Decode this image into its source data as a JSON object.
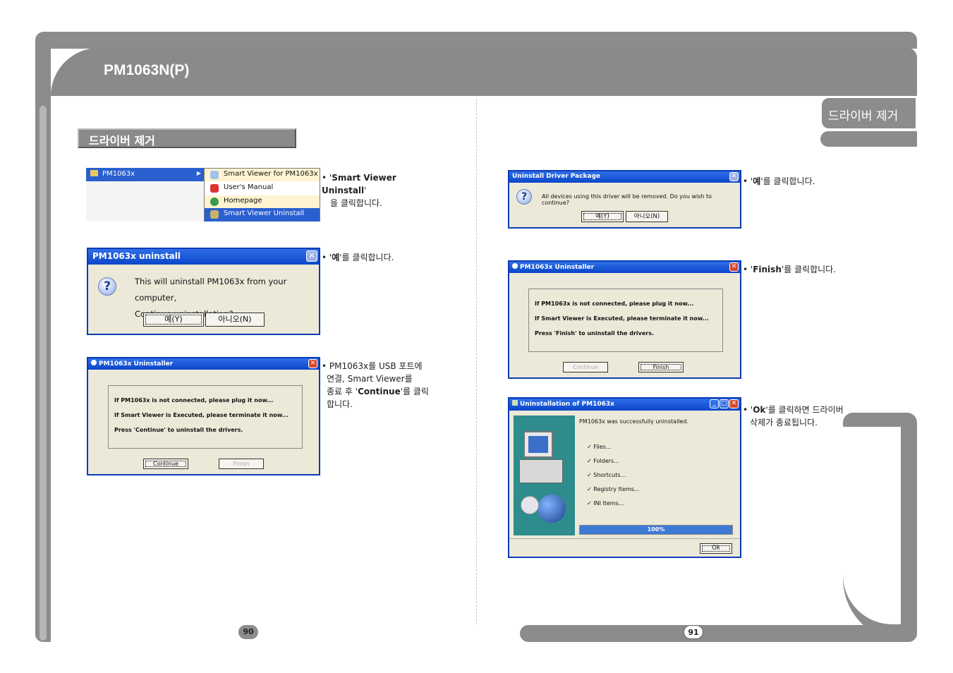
{
  "header": {
    "title": "PM1063N(P)",
    "tab_label": "드라이버 제거"
  },
  "left": {
    "section_title": "드라이버 제거",
    "page_number": "90",
    "menu": {
      "main": "PM1063x",
      "items": [
        "Smart Viewer for PM1063x",
        "User's Manual",
        "Homepage",
        "Smart Viewer Uninstall"
      ]
    },
    "step1": {
      "pre": "• '",
      "bold": "Smart Viewer Uninstall",
      "post": "'",
      "line2": "을 클릭합니다."
    },
    "dialog1": {
      "title": "PM1063x uninstall",
      "line1": "This will uninstall PM1063x from your computer,",
      "line2": "Continue uninstallation?",
      "yes": "예(Y)",
      "no": "아니오(N)"
    },
    "step2": {
      "pre": "• '",
      "bold": "예",
      "post": "'를 클릭합니다."
    },
    "dialog2": {
      "title": "PM1063x Uninstaller",
      "line1": "If PM1063x is not connected, please plug it now...",
      "line2": "If Smart Viewer is Executed, please terminate it now...",
      "line3": "Press 'Continue' to uninstall the drivers.",
      "continue": "Continue",
      "finish": "Finish"
    },
    "step3": {
      "line1": "• PM1063x를 USB 포트에",
      "line2": "연결, Smart Viewer를",
      "line3_pre": "종료 후 '",
      "bold": "Continue",
      "line3_post": "'를 클릭",
      "line4": "합니다."
    }
  },
  "right": {
    "page_number": "91",
    "dialog3": {
      "title": "Uninstall Driver Package",
      "message": "All devices using this driver will be removed.  Do you wish to continue?",
      "yes": "예(Y)",
      "no": "아니오(N)"
    },
    "step4": {
      "pre": "• '",
      "bold": "예",
      "post": "'를 클릭합니다."
    },
    "dialog4": {
      "title": "PM1063x Uninstaller",
      "line1": "If PM1063x is not connected, please plug it now...",
      "line2": "If Smart Viewer is Executed, please terminate it now...",
      "line3": "Press 'Finish' to uninstall the drivers.",
      "continue": "Continue",
      "finish": "Finish"
    },
    "step5": {
      "pre": "• '",
      "bold": "Finish",
      "post": "'를 클릭합니다."
    },
    "dialog5": {
      "title": "Uninstallation of PM1063x",
      "message": "PM1063x was successfully uninstalled.",
      "items": [
        "Files...",
        "Folders...",
        "Shortcuts...",
        "Registry Items...",
        "INI Items..."
      ],
      "progress_label": "100%",
      "progress": 1.0,
      "ok": "Ok"
    },
    "step6": {
      "pre": "• '",
      "bold": "Ok",
      "post": "'를 클릭하면 드라이버",
      "line2": "삭제가 종료됩니다."
    }
  }
}
